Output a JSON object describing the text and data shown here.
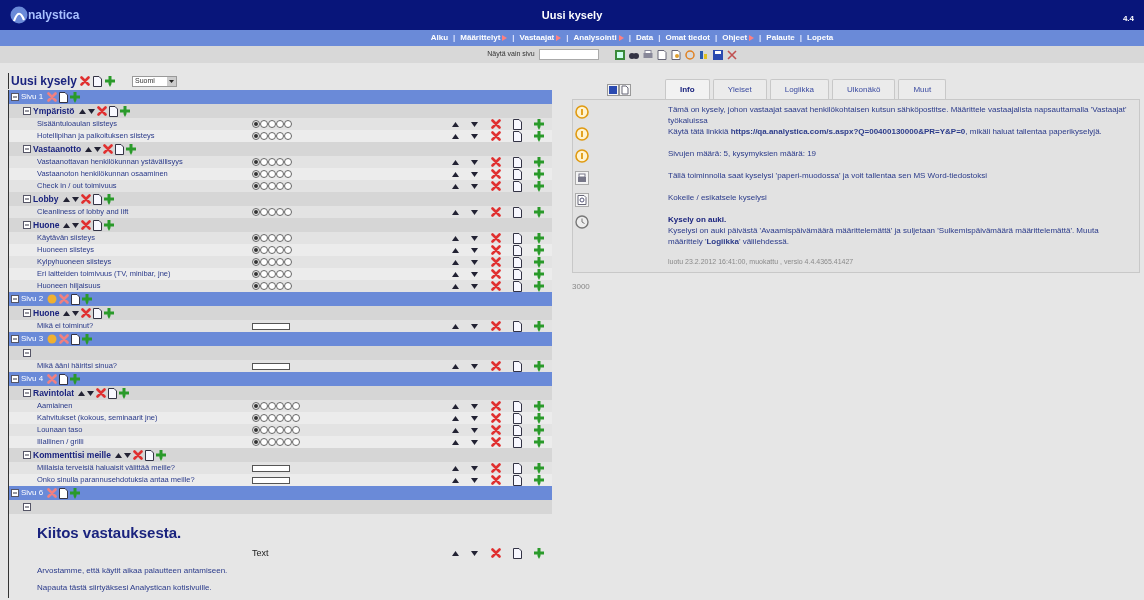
{
  "header": {
    "logo": "nalystica",
    "title": "Uusi kysely",
    "version": "4.4"
  },
  "nav": [
    {
      "label": "Alku",
      "submenu": false
    },
    {
      "separator": "|",
      "label": "Määrittelyt",
      "submenu": true
    },
    {
      "separator": "|",
      "label": "Vastaajat",
      "submenu": true
    },
    {
      "separator": "|",
      "label": "Analysointi",
      "submenu": true
    },
    {
      "separator": "|",
      "label": "Data",
      "submenu": false
    },
    {
      "separator": "|",
      "label": "Omat tiedot",
      "submenu": false
    },
    {
      "separator": "|",
      "label": "Ohjeet",
      "submenu": true
    },
    {
      "separator": "|",
      "label": "Palaute",
      "submenu": false
    },
    {
      "separator": "|",
      "label": "Lopeta",
      "submenu": false
    }
  ],
  "toolbar": {
    "filter_label": "Näytä vain sivu"
  },
  "survey": {
    "title": "Uusi kysely",
    "language": "Suomi",
    "pages": [
      {
        "label": "Sivu 1",
        "warning": false,
        "groups": [
          {
            "title": "Ympäristö",
            "items": [
              {
                "kind": "scale",
                "text": "Sisääntuloaulan siisteys",
                "points": [
                  true,
                  false,
                  false,
                  false,
                  false
                ]
              },
              {
                "kind": "scale",
                "text": "Hotellipihan ja paikoituksen siisteys",
                "points": [
                  true,
                  false,
                  false,
                  false,
                  false
                ]
              }
            ]
          },
          {
            "title": "Vastaanotto",
            "items": [
              {
                "kind": "scale",
                "text": "Vastaanottavan henkilökunnan ystävällisyys",
                "points": [
                  true,
                  false,
                  false,
                  false,
                  false
                ]
              },
              {
                "kind": "scale",
                "text": "Vastaanoton henkilökunnan osaaminen",
                "points": [
                  true,
                  false,
                  false,
                  false,
                  false
                ]
              },
              {
                "kind": "scale",
                "text": "Check in / out toimivuus",
                "points": [
                  true,
                  false,
                  false,
                  false,
                  false
                ]
              }
            ]
          },
          {
            "title": "Lobby",
            "items": [
              {
                "kind": "scale",
                "text": "Cleanliness of lobby and lift",
                "points": [
                  true,
                  false,
                  false,
                  false,
                  false
                ]
              }
            ]
          },
          {
            "title": "Huone",
            "items": [
              {
                "kind": "scale",
                "text": "Käytävän siisteys",
                "points": [
                  true,
                  false,
                  false,
                  false,
                  false
                ]
              },
              {
                "kind": "scale",
                "text": "Huoneen siisteys",
                "points": [
                  true,
                  false,
                  false,
                  false,
                  false
                ]
              },
              {
                "kind": "scale",
                "text": "Kylpyhuoneen siisteys",
                "points": [
                  true,
                  false,
                  false,
                  false,
                  false
                ]
              },
              {
                "kind": "scale",
                "text": "Eri laitteiden toimivuus (TV, minibar, jne)",
                "points": [
                  true,
                  false,
                  false,
                  false,
                  false
                ]
              },
              {
                "kind": "scale",
                "text": "Huoneen hiljaisuus",
                "points": [
                  true,
                  false,
                  false,
                  false,
                  false
                ]
              }
            ]
          }
        ]
      },
      {
        "label": "Sivu 2",
        "warning": true,
        "groups": [
          {
            "title": "Huone",
            "items": [
              {
                "kind": "textbox",
                "text": "Mikä ei toiminut?"
              }
            ]
          }
        ]
      },
      {
        "label": "Sivu 3",
        "warning": true,
        "groups": [
          {
            "items": [
              {
                "kind": "textbox",
                "text": "Mikä ääni häiritsi sinua?"
              }
            ]
          }
        ]
      },
      {
        "label": "Sivu 4",
        "warning": false,
        "groups": [
          {
            "title": "Ravintolat",
            "items": [
              {
                "kind": "scale",
                "text": "Aamiainen",
                "points": [
                  true,
                  false,
                  false,
                  false,
                  false,
                  false
                ]
              },
              {
                "kind": "scale",
                "text": "Kahvitukset (kokous, seminaarit jne)",
                "points": [
                  true,
                  false,
                  false,
                  false,
                  false,
                  false
                ]
              },
              {
                "kind": "scale",
                "text": "Lounaan taso",
                "points": [
                  true,
                  false,
                  false,
                  false,
                  false,
                  false
                ]
              },
              {
                "kind": "scale",
                "text": "Illallinen / grilli",
                "points": [
                  true,
                  false,
                  false,
                  false,
                  false,
                  false
                ]
              }
            ]
          },
          {
            "title": "Kommenttisi meille",
            "items": [
              {
                "kind": "textbox",
                "text": "Millaisia terveisiä haluaisit välittää meille?"
              },
              {
                "kind": "textbox",
                "text": "Onko sinulla parannusehdotuksia antaa meille?"
              }
            ]
          }
        ]
      },
      {
        "label": "Sivu 6",
        "warning": false,
        "groups": [
          {
            "items": [
              {
                "kind": "text",
                "heading": "Kiitos vastauksesta.",
                "label": "Text",
                "paragraphs": [
                  "Arvostamme, että käytit aikaa palautteen antamiseen.",
                  "Napauta tästä siirtyäksesi Analystican kotisivuille."
                ]
              }
            ]
          }
        ]
      }
    ]
  },
  "details": {
    "tabs": [
      {
        "label": "Info",
        "selected": true
      },
      {
        "label": "Yleiset",
        "selected": false
      },
      {
        "label": "Logiikka",
        "selected": false
      },
      {
        "label": "Ulkonäkö",
        "selected": false
      },
      {
        "label": "Muut",
        "selected": false
      }
    ],
    "rows": [
      {
        "kind": "info",
        "text": "Tämä on kysely, johon vastaajat saavat henkilökohtaisen kutsun sähköpostitse. Määrittele vastaajalista napsauttamalla 'Vastaajat' työkaluissa"
      },
      {
        "kind": "info",
        "text": "Käytä tätä linkkiä **https://qa.analystica.com/s.aspx?Q=00400130000&PR=Y&P=0**, mikäli haluat tallentaa paperikyselyjä."
      },
      {
        "kind": "info",
        "text": "Sivujen määrä: 5, kysymyksien määrä: 19"
      },
      {
        "kind": "print",
        "text": "Tällä toiminnolla saat kyselysi 'paperi-muodossa' ja voit tallentaa sen MS Word-tiedostoksi"
      },
      {
        "kind": "preview",
        "text": "Kokeile / esikatsele kyselysi"
      },
      {
        "kind": "clock",
        "title": "Kysely on auki.",
        "text": "Kyselysi on auki päivästä 'Avaamispäivämäärä määrittelemättä' ja suljetaan 'Sulkemispäivämäärä määrittelemättä'. Muuta määrittely '**Logiikka**' välilehdessä."
      }
    ],
    "meta": "luotu 23.2.2012 16:41:00, muokattu , versio 4.4.4365.41427",
    "counter": "3000"
  }
}
